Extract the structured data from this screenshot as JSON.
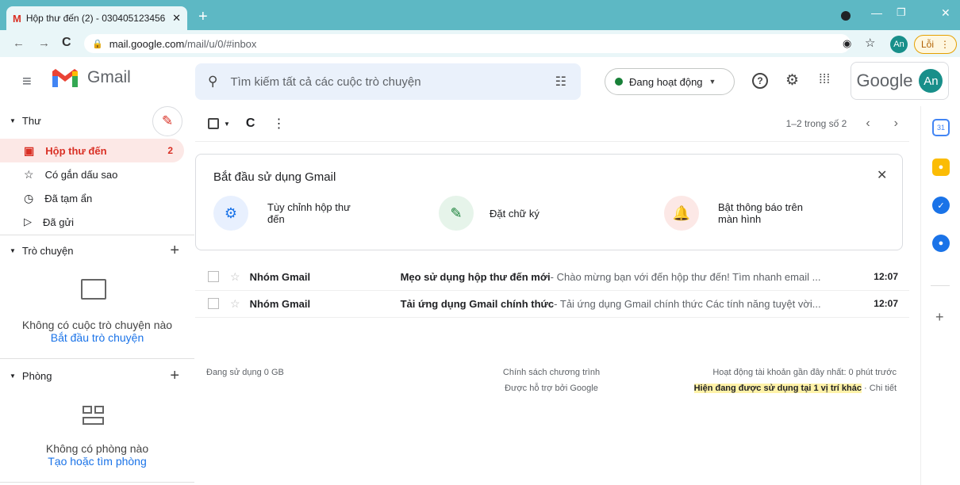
{
  "browser": {
    "tab_title": "Hộp thư đến (2) - 030405123456",
    "url_host": "mail.google.com",
    "url_path": "/mail/u/0/#inbox",
    "profile": "An",
    "error_label": "Lỗi"
  },
  "header": {
    "app_name": "Gmail",
    "search_placeholder": "Tìm kiếm tất cả các cuộc trò chuyện",
    "status": "Đang hoạt động",
    "google_label": "Google",
    "avatar": "An"
  },
  "sidebar": {
    "mail_section": "Thư",
    "items": [
      {
        "label": "Hộp thư đến",
        "count": "2"
      },
      {
        "label": "Có gắn dấu sao",
        "count": ""
      },
      {
        "label": "Đã tạm ẩn",
        "count": ""
      },
      {
        "label": "Đã gửi",
        "count": ""
      }
    ],
    "chat_section": "Trò chuyện",
    "chat_empty": "Không có cuộc trò chuyện nào",
    "chat_link": "Bắt đầu trò chuyện",
    "rooms_section": "Phòng",
    "rooms_empty": "Không có phòng nào",
    "rooms_link": "Tạo hoặc tìm phòng"
  },
  "toolbar": {
    "pagination": "1–2 trong số 2"
  },
  "getting_started": {
    "title": "Bắt đầu sử dụng Gmail",
    "tips": [
      {
        "label": "Tùy chỉnh hộp thư đến"
      },
      {
        "label": "Đặt chữ ký"
      },
      {
        "label": "Bật thông báo trên màn hình"
      }
    ]
  },
  "emails": [
    {
      "sender": "Nhóm Gmail",
      "subject": "Mẹo sử dụng hộp thư đến mới",
      "snippet": " - Chào mừng bạn với đến hộp thư đến! Tìm nhanh email ...",
      "time": "12:07"
    },
    {
      "sender": "Nhóm Gmail",
      "subject": "Tải ứng dụng Gmail chính thức",
      "snippet": " - Tải ứng dụng Gmail chính thức Các tính năng tuyệt vời...",
      "time": "12:07"
    }
  ],
  "footer": {
    "storage": "Đang sử dụng 0 GB",
    "policy": "Chính sách chương trình",
    "powered": "Được hỗ trợ bởi Google",
    "activity": "Hoạt động tài khoản gần đây nhất: 0 phút trước",
    "in_use": "Hiện đang được sử dụng tại 1 vị trí khác",
    "details": " · Chi tiết"
  },
  "colors": {
    "accent": "#d93025",
    "brand_teal": "#5db8c4",
    "link": "#1a73e8"
  }
}
